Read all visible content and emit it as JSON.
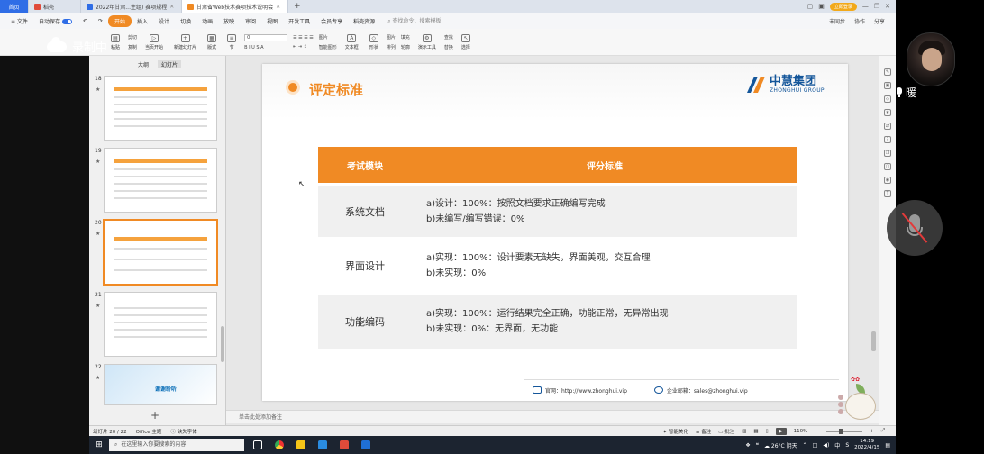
{
  "browser": {
    "tabs": [
      {
        "label": "首页",
        "kind": "home"
      },
      {
        "label": "稻壳",
        "kind": "normal"
      },
      {
        "label": "2022年甘肃...生组) 赛项规程",
        "kind": "normal"
      },
      {
        "label": "甘肃省Web技术赛项技术说明会",
        "kind": "active"
      }
    ],
    "add_label": "+",
    "login_label": "立即登录"
  },
  "menu": {
    "items": [
      "≡ 文件",
      "自动保存",
      "开始",
      "插入",
      "设计",
      "切换",
      "动画",
      "放映",
      "审阅",
      "视图",
      "开发工具",
      "会员专享",
      "稻壳资源"
    ],
    "search_label": "查找命令、搜索模板",
    "right": [
      "未同步",
      "协作",
      "分享"
    ]
  },
  "ribbon": {
    "buttons": [
      "粘贴",
      "当页开始",
      "新建幻灯片",
      "版式",
      "节",
      "形状",
      "图片",
      "排列",
      "文本框",
      "演示工具",
      "查找",
      "替换",
      "选择"
    ],
    "col_left": [
      "剪切",
      "复制",
      "格式刷"
    ],
    "font_box": "0",
    "col_mid": [
      "图片",
      "智能图形",
      "填充",
      "轮廓"
    ]
  },
  "recording": {
    "label": "录制中"
  },
  "panel": {
    "tabs": [
      "大纲",
      "幻灯片"
    ],
    "thumbs": [
      {
        "num": "18",
        "star": "★"
      },
      {
        "num": "19",
        "star": "★"
      },
      {
        "num": "20",
        "star": "★"
      },
      {
        "num": "21",
        "star": "★"
      },
      {
        "num": "22",
        "star": "★",
        "thanks": "谢谢聆听！"
      }
    ],
    "add_label": "+"
  },
  "slide": {
    "title": "评定标准",
    "logo_zh": "中慧集团",
    "logo_en": "ZHONGHUI GROUP",
    "table": {
      "headers": [
        "考试模块",
        "评分标准"
      ],
      "rows": [
        {
          "module": "系统文档",
          "lines": [
            "a)设计：100%：按照文档要求正确编写完成",
            "b)未编写/编写错误：0%"
          ]
        },
        {
          "module": "界面设计",
          "lines": [
            "a)实现：100%：设计要素无缺失，界面美观，交互合理",
            "b)未实现：0%"
          ]
        },
        {
          "module": "功能编码",
          "lines": [
            "a)实现：100%：运行结果完全正确，功能正常，无异常出现",
            "b)未实现：0%：无界面，无功能"
          ]
        }
      ]
    },
    "footer": {
      "site": "官网：http://www.zhonghui.vip",
      "email": "企业邮箱：sales@zhonghui.vip"
    }
  },
  "notes": {
    "placeholder": "单击此处添加备注"
  },
  "status": {
    "slide_pos": "幻灯片 20 / 22",
    "theme": "Office 主题",
    "missing_font": "缺失字体",
    "smart_beautify": "智能美化",
    "notes": "备注",
    "comments": "批注",
    "zoom": "110%"
  },
  "taskbar": {
    "search": "在这里输入你要搜索的内容",
    "weather": "26°C 阴天",
    "ime": "中",
    "time": "14:19",
    "date": "2022/4/15"
  },
  "meeting": {
    "speaker_name": "暖"
  },
  "colors": {
    "accent": "#f08a24",
    "brand_blue": "#14569a",
    "taskbar": "#1c2430"
  }
}
